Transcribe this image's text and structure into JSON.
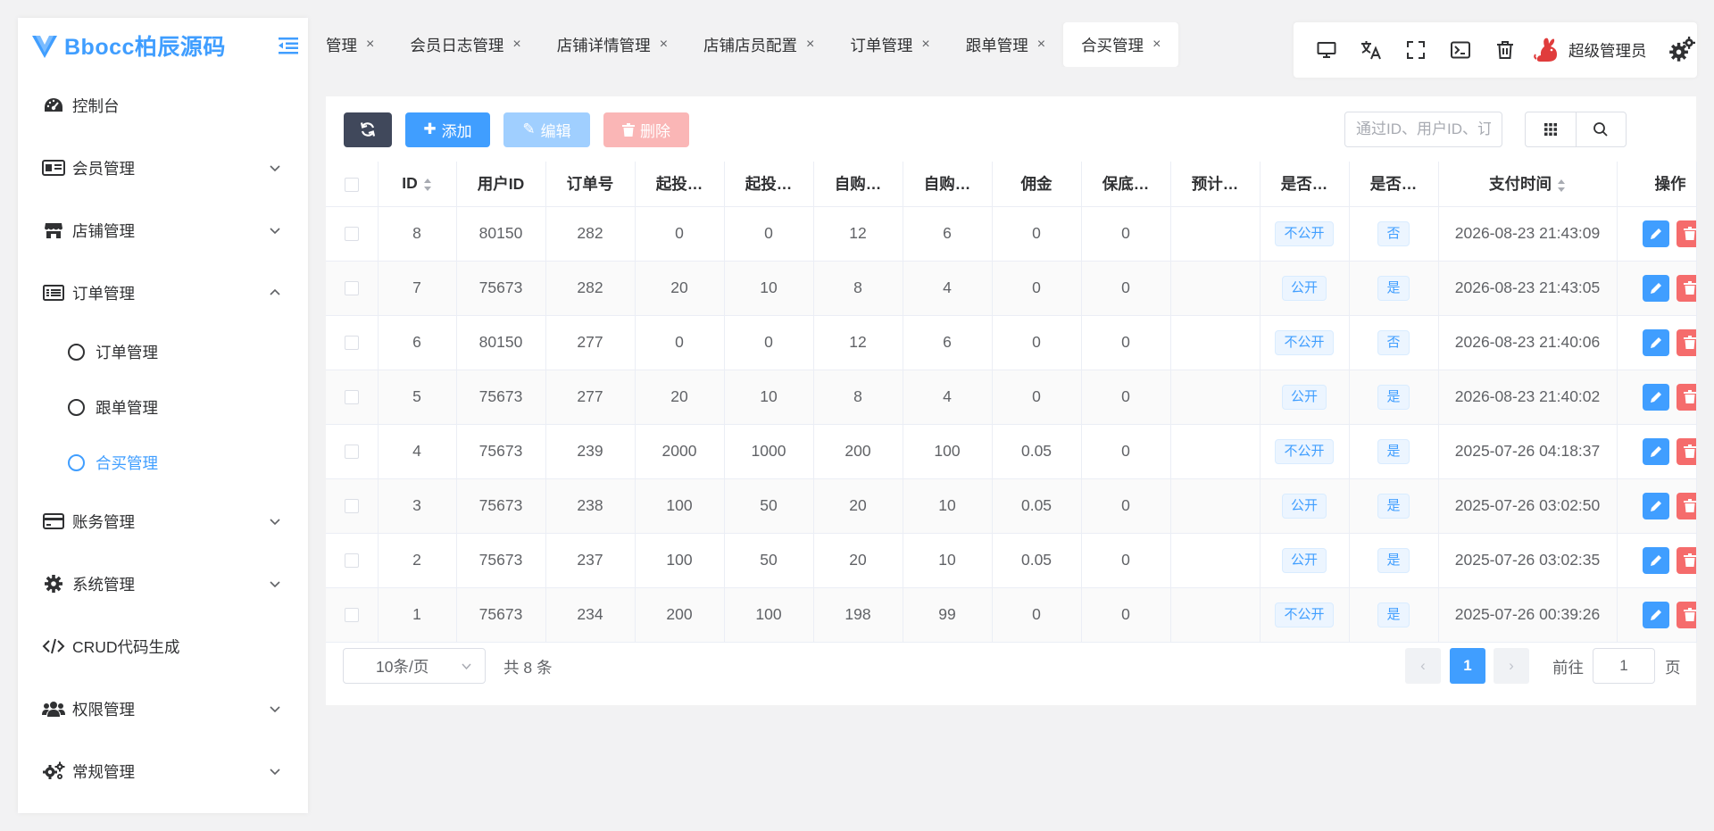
{
  "app": {
    "logo_text": "Bbocc柏辰源码"
  },
  "sidebar": {
    "items": [
      {
        "label": "控制台",
        "icon": "dashboard-icon"
      },
      {
        "label": "会员管理",
        "icon": "member-card-icon"
      },
      {
        "label": "店铺管理",
        "icon": "shop-icon"
      },
      {
        "label": "订单管理",
        "icon": "list-icon",
        "expanded": true
      },
      {
        "label": "账务管理",
        "icon": "credit-card-icon"
      },
      {
        "label": "系统管理",
        "icon": "gear-icon"
      },
      {
        "label": "CRUD代码生成",
        "icon": "code-icon"
      },
      {
        "label": "权限管理",
        "icon": "users-icon"
      },
      {
        "label": "常规管理",
        "icon": "gears-icon"
      }
    ],
    "order_sub": [
      {
        "label": "订单管理"
      },
      {
        "label": "跟单管理"
      },
      {
        "label": "合买管理",
        "active": true
      }
    ]
  },
  "tabs": [
    {
      "label": "管理",
      "close": "×"
    },
    {
      "label": "会员日志管理",
      "close": "×"
    },
    {
      "label": "店铺详情管理",
      "close": "×"
    },
    {
      "label": "店铺店员配置",
      "close": "×"
    },
    {
      "label": "订单管理",
      "close": "×"
    },
    {
      "label": "跟单管理",
      "close": "×"
    },
    {
      "label": "合买管理",
      "close": "×",
      "active": true
    }
  ],
  "topbar": {
    "admin_name": "超级管理员"
  },
  "toolbar": {
    "add_label": "添加",
    "edit_label": "编辑",
    "delete_label": "删除",
    "search_placeholder": "通过ID、用户ID、订单号模糊搜索"
  },
  "table": {
    "columns": [
      "ID",
      "用户ID",
      "订单号",
      "起投…",
      "起投…",
      "自购…",
      "自购…",
      "佣金",
      "保底…",
      "预计…",
      "是否…",
      "是否…",
      "支付时间",
      "操作"
    ],
    "rows": [
      {
        "id": "8",
        "user_id": "80150",
        "order_no": "282",
        "c4": "0",
        "c5": "0",
        "c6": "12",
        "c7": "6",
        "commission": "0",
        "c9": "0",
        "c10": "",
        "public": "不公开",
        "flag": "否",
        "pay_time": "2026-08-23 21:43:09"
      },
      {
        "id": "7",
        "user_id": "75673",
        "order_no": "282",
        "c4": "20",
        "c5": "10",
        "c6": "8",
        "c7": "4",
        "commission": "0",
        "c9": "0",
        "c10": "",
        "public": "公开",
        "flag": "是",
        "pay_time": "2026-08-23 21:43:05"
      },
      {
        "id": "6",
        "user_id": "80150",
        "order_no": "277",
        "c4": "0",
        "c5": "0",
        "c6": "12",
        "c7": "6",
        "commission": "0",
        "c9": "0",
        "c10": "",
        "public": "不公开",
        "flag": "否",
        "pay_time": "2026-08-23 21:40:06"
      },
      {
        "id": "5",
        "user_id": "75673",
        "order_no": "277",
        "c4": "20",
        "c5": "10",
        "c6": "8",
        "c7": "4",
        "commission": "0",
        "c9": "0",
        "c10": "",
        "public": "公开",
        "flag": "是",
        "pay_time": "2026-08-23 21:40:02"
      },
      {
        "id": "4",
        "user_id": "75673",
        "order_no": "239",
        "c4": "2000",
        "c5": "1000",
        "c6": "200",
        "c7": "100",
        "commission": "0.05",
        "c9": "0",
        "c10": "",
        "public": "不公开",
        "flag": "是",
        "pay_time": "2025-07-26 04:18:37"
      },
      {
        "id": "3",
        "user_id": "75673",
        "order_no": "238",
        "c4": "100",
        "c5": "50",
        "c6": "20",
        "c7": "10",
        "commission": "0.05",
        "c9": "0",
        "c10": "",
        "public": "公开",
        "flag": "是",
        "pay_time": "2025-07-26 03:02:50"
      },
      {
        "id": "2",
        "user_id": "75673",
        "order_no": "237",
        "c4": "100",
        "c5": "50",
        "c6": "20",
        "c7": "10",
        "commission": "0.05",
        "c9": "0",
        "c10": "",
        "public": "公开",
        "flag": "是",
        "pay_time": "2025-07-26 03:02:35"
      },
      {
        "id": "1",
        "user_id": "75673",
        "order_no": "234",
        "c4": "200",
        "c5": "100",
        "c6": "198",
        "c7": "99",
        "commission": "0",
        "c9": "0",
        "c10": "",
        "public": "不公开",
        "flag": "是",
        "pay_time": "2025-07-26 00:39:26"
      }
    ]
  },
  "pagination": {
    "page_size": "10条/页",
    "total": "共 8 条",
    "current_page": "1",
    "goto_label": "前往",
    "goto_value": "1",
    "page_suffix": "页",
    "prev": "‹",
    "next": "›"
  },
  "colors": {
    "accent": "#409eff",
    "danger": "#f56c6c",
    "dark_button": "#40485b"
  }
}
